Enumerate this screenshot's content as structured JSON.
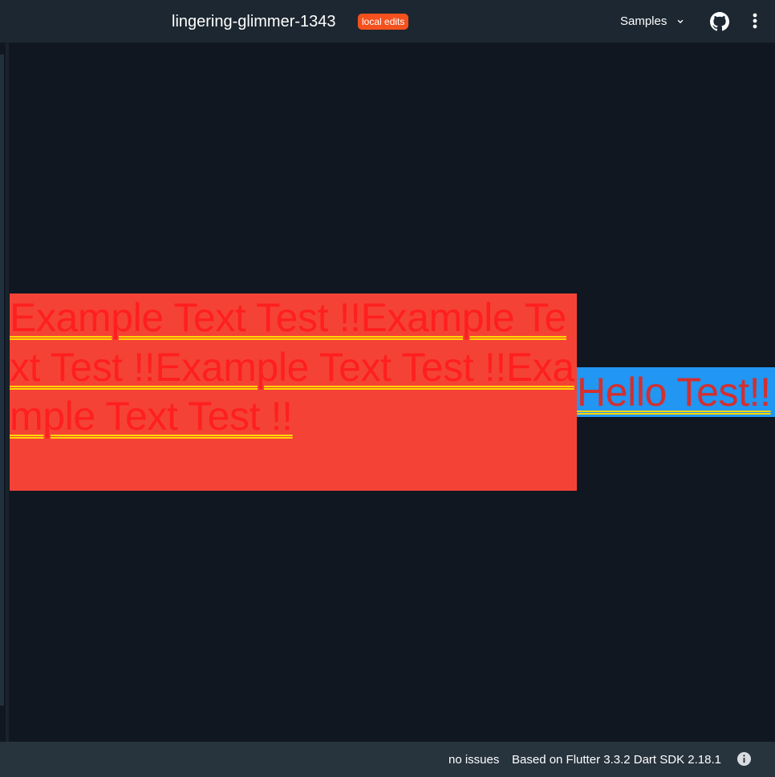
{
  "header": {
    "title": "lingering-glimmer-1343",
    "badge": "local edits",
    "samples_label": "Samples",
    "icons": {
      "dropdown": "chevron-down-icon",
      "github": "github-icon",
      "menu": "more-vert-icon"
    }
  },
  "preview": {
    "red_box_text": "Example Text Test !!Example Text Test !!Example Text Test !!Example Text Test !!",
    "blue_box_text": "Hello Test!!"
  },
  "status": {
    "issues": "no issues",
    "version": "Based on Flutter 3.3.2 Dart SDK 2.18.1",
    "info_icon": "info-icon"
  },
  "colors": {
    "background": "#101720",
    "header": "#1d2731",
    "statusbar": "#27333d",
    "badge": "#f4511e",
    "red_box": "#f44336",
    "red_text": "#ff1f1f",
    "blue_box": "#2196f3",
    "blue_text": "#d32f2f",
    "underline": "#ffd600"
  }
}
